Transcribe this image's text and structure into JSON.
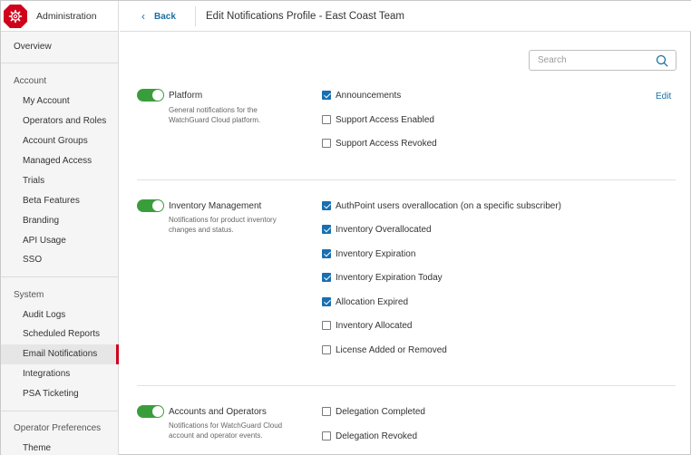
{
  "sidebar": {
    "header_title": "Administration",
    "overview": "Overview",
    "sections": [
      {
        "title": "Account",
        "items": [
          "My Account",
          "Operators and Roles",
          "Account Groups",
          "Managed Access",
          "Trials",
          "Beta Features",
          "Branding",
          "API Usage",
          "SSO"
        ]
      },
      {
        "title": "System",
        "items": [
          "Audit Logs",
          "Scheduled Reports",
          "Email Notifications",
          "Integrations",
          "PSA Ticketing"
        ]
      },
      {
        "title": "Operator Preferences",
        "items": [
          "Theme"
        ]
      }
    ],
    "active_item": "Email Notifications"
  },
  "topbar": {
    "back_label": "Back",
    "title": "Edit Notifications Profile - East Coast Team"
  },
  "search": {
    "placeholder": "Search",
    "value": ""
  },
  "edit_label": "Edit",
  "colors": {
    "accent": "#d0021b",
    "toggle_on": "#3a9d3c",
    "link": "#1a6fa3",
    "checkbox": "#1a6fb0"
  },
  "groups": [
    {
      "title": "Platform",
      "enabled": true,
      "description": "General notifications for the WatchGuard Cloud platform.",
      "options": [
        {
          "label": "Announcements",
          "checked": true
        },
        {
          "label": "Support Access Enabled",
          "checked": false
        },
        {
          "label": "Support Access Revoked",
          "checked": false
        }
      ]
    },
    {
      "title": "Inventory Management",
      "enabled": true,
      "description": "Notifications for product inventory changes and status.",
      "options": [
        {
          "label": "AuthPoint users overallocation (on a specific subscriber)",
          "checked": true
        },
        {
          "label": "Inventory Overallocated",
          "checked": true
        },
        {
          "label": "Inventory Expiration",
          "checked": true
        },
        {
          "label": "Inventory Expiration Today",
          "checked": true
        },
        {
          "label": "Allocation Expired",
          "checked": true
        },
        {
          "label": "Inventory Allocated",
          "checked": false
        },
        {
          "label": "License Added or Removed",
          "checked": false
        }
      ]
    },
    {
      "title": "Accounts and Operators",
      "enabled": true,
      "description": "Notifications for WatchGuard Cloud account and operator events.",
      "options": [
        {
          "label": "Delegation Completed",
          "checked": false
        },
        {
          "label": "Delegation Revoked",
          "checked": false
        }
      ]
    }
  ]
}
